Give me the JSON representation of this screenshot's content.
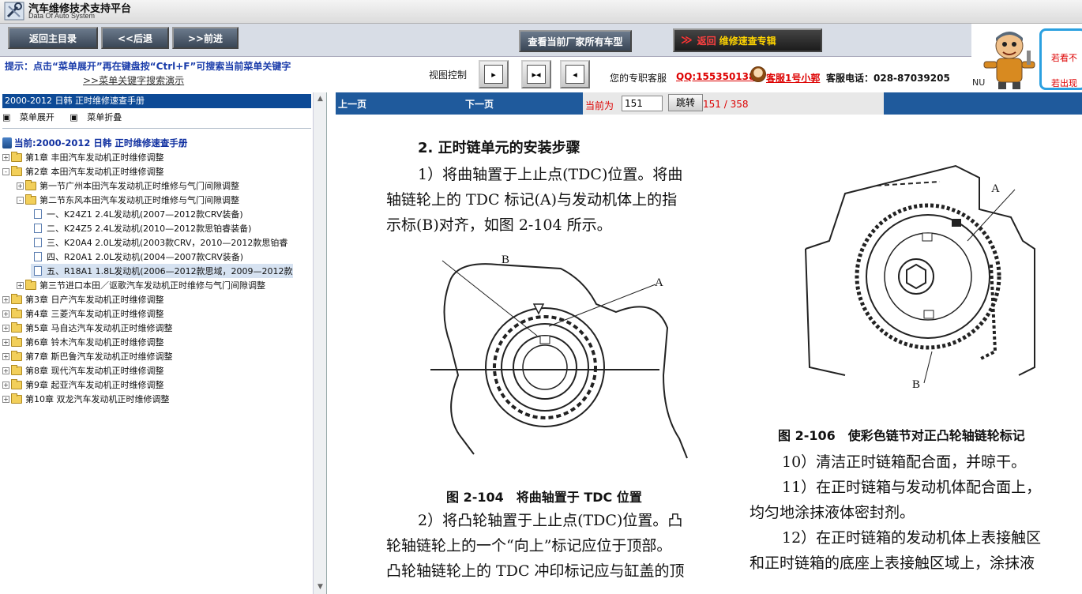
{
  "titlebar": {
    "title": "汽车维修技术支持平台",
    "subtitle": "Data Of Auto System"
  },
  "toolbar": {
    "home": "返回主目录",
    "back": "<<后退",
    "forward": ">>前进",
    "models": "查看当前厂家所有车型",
    "return_arrows": "≫",
    "return_label": "返回",
    "return_title": "维修速查专辑"
  },
  "hint": {
    "text": "提示：点击“菜单展开”再在键盘按“Ctrl+F”可搜索当前菜单关键字",
    "link": ">>菜单关键字搜索演示"
  },
  "view": {
    "label": "视图控制",
    "btn1": "▸",
    "btn2": "▸◂",
    "btn3": "◂"
  },
  "support": {
    "label": "您的专职客服",
    "qq": "QQ:1553501388",
    "kefu": "客服1号小郭",
    "phone": "客服电话：028-87039205"
  },
  "mascot": {
    "nu": "NU",
    "promo1": "若看不",
    "promo2": "若出现"
  },
  "sidebar": {
    "header": "2000-2012 日韩 正时维修速查手册",
    "expand": "菜单展开",
    "collapse": "菜单折叠",
    "root": "当前:2000-2012 日韩 正时维修速查手册",
    "items": [
      {
        "label": "第1章 丰田汽车发动机正时维修调整",
        "level": 0,
        "toggle": "+",
        "type": "folder"
      },
      {
        "label": "第2章 本田汽车发动机正时维修调整",
        "level": 0,
        "toggle": "-",
        "type": "folder"
      },
      {
        "label": "第一节广州本田汽车发动机正时维修与气门间隙调整",
        "level": 1,
        "toggle": "+",
        "type": "folder"
      },
      {
        "label": "第二节东风本田汽车发动机正时维修与气门间隙调整",
        "level": 1,
        "toggle": "-",
        "type": "folder"
      },
      {
        "label": "一、K24Z1 2.4L发动机(2007—2012款CRV装备)",
        "level": 2,
        "toggle": "",
        "type": "doc"
      },
      {
        "label": "二、K24Z5 2.4L发动机(2010—2012款思铂睿装备)",
        "level": 2,
        "toggle": "",
        "type": "doc"
      },
      {
        "label": "三、K20A4 2.0L发动机(2003款CRV，2010—2012款思铂睿",
        "level": 2,
        "toggle": "",
        "type": "doc"
      },
      {
        "label": "四、R20A1 2.0L发动机(2004—2007款CRV装备)",
        "level": 2,
        "toggle": "",
        "type": "doc"
      },
      {
        "label": "五、R18A1 1.8L发动机(2006—2012款思域，2009—2012款",
        "level": 2,
        "toggle": "",
        "type": "doc",
        "selected": true
      },
      {
        "label": "第三节进口本田／讴歌汽车发动机正时维修与气门间隙调整",
        "level": 1,
        "toggle": "+",
        "type": "folder"
      },
      {
        "label": "第3章 日产汽车发动机正时维修调整",
        "level": 0,
        "toggle": "+",
        "type": "folder"
      },
      {
        "label": "第4章 三菱汽车发动机正时维修调整",
        "level": 0,
        "toggle": "+",
        "type": "folder"
      },
      {
        "label": "第5章 马自达汽车发动机正时维修调整",
        "level": 0,
        "toggle": "+",
        "type": "folder"
      },
      {
        "label": "第6章 铃木汽车发动机正时维修调整",
        "level": 0,
        "toggle": "+",
        "type": "folder"
      },
      {
        "label": "第7章 斯巴鲁汽车发动机正时维修调整",
        "level": 0,
        "toggle": "+",
        "type": "folder"
      },
      {
        "label": "第8章 现代汽车发动机正时维修调整",
        "level": 0,
        "toggle": "+",
        "type": "folder"
      },
      {
        "label": "第9章 起亚汽车发动机正时维修调整",
        "level": 0,
        "toggle": "+",
        "type": "folder"
      },
      {
        "label": "第10章 双龙汽车发动机正时维修调整",
        "level": 0,
        "toggle": "+",
        "type": "folder"
      }
    ]
  },
  "pager": {
    "prev": "上一页",
    "next": "下一页",
    "current_label": "当前为",
    "current_value": "151",
    "jump": "跳转",
    "count": "151 / 358"
  },
  "doc": {
    "heading": "2. 正时链单元的安装步骤",
    "p1_l1": "1）将曲轴置于上止点(TDC)位置。将曲",
    "p1_l2": "轴链轮上的 TDC 标记(A)与发动机体上的指",
    "p1_l3": "示标(B)对齐，如图 2-104 所示。",
    "fig104_caption": "图 2-104　将曲轴置于 TDC 位置",
    "fig104_a": "A",
    "fig104_b": "B",
    "p2_l1": "2）将凸轮轴置于上止点(TDC)位置。凸",
    "p2_l2": "轮轴链轮上的一个“向上”标记应位于顶部。",
    "p2_l3": "凸轮轴链轮上的 TDC 冲印标记应与缸盖的顶",
    "fig106_a": "A",
    "fig106_b": "B",
    "fig106_caption": "图 2-106　使彩色链节对正凸轮轴链轮标记",
    "p10": "10）清洁正时链箱配合面，并晾干。",
    "p11_l1": "11）在正时链箱与发动机体配合面上，",
    "p11_l2": "均匀地涂抹液体密封剂。",
    "p12_l1": "12）在正时链箱的发动机体上表接触区",
    "p12_l2": "和正时链箱的底座上表接触区域上，涂抹液"
  }
}
